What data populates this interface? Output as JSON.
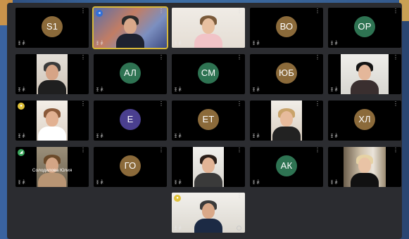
{
  "colors": {
    "tile_background": "#000000",
    "meeting_background": "#2b2c30",
    "active_speaker_border": "#d8b93a"
  },
  "icons": {
    "tile_status": "mic-muted-icon",
    "tile_menu": "more-options-icon"
  },
  "tiles": [
    {
      "kind": "avatar",
      "initials": "S1",
      "color": "#8b6a3a",
      "status": "ꀨ ꅕ"
    },
    {
      "kind": "video",
      "status": "ꀨ ꅕ",
      "badge": "◂",
      "badge_color": "#2f6fd8"
    },
    {
      "kind": "video",
      "status": "ꀨ ꅕ"
    },
    {
      "kind": "avatar",
      "initials": "ВО",
      "color": "#8b6a3a",
      "status": "ꀨ ꅕ"
    },
    {
      "kind": "avatar",
      "initials": "ОР",
      "color": "#2e7352",
      "status": "ꀨ ꅕ"
    },
    {
      "kind": "video",
      "status": "ꀨ ꅕ"
    },
    {
      "kind": "avatar",
      "initials": "АЛ",
      "color": "#2e7352",
      "status": "ꀨ ꅕ"
    },
    {
      "kind": "avatar",
      "initials": "СМ",
      "color": "#2e7352",
      "status": "ꀨ ꅕ"
    },
    {
      "kind": "avatar",
      "initials": "ЮБ",
      "color": "#8b6a3a",
      "status": "ꀨ ꅕ"
    },
    {
      "kind": "video",
      "status": "ꀨ ꅕ"
    },
    {
      "kind": "video",
      "status": "ꀨ ꅕ",
      "badge": "●",
      "badge_color": "#e0c23a"
    },
    {
      "kind": "avatar",
      "initials": "Е",
      "color": "#4a3f8f",
      "status": "ꀨ ꅕ"
    },
    {
      "kind": "avatar",
      "initials": "ЕТ",
      "color": "#8b6a3a",
      "status": "ꀨ ꅕ"
    },
    {
      "kind": "video",
      "status": "ꀨ ꅕ"
    },
    {
      "kind": "avatar",
      "initials": "ХЛ",
      "color": "#8b6a3a",
      "status": "ꀨ ꅕ"
    },
    {
      "kind": "video",
      "status": "ꀨ ꅕ",
      "badge": "◢",
      "badge_color": "#3aa55c",
      "overlay_name": "Солодилова Юлия"
    },
    {
      "kind": "avatar",
      "initials": "ГО",
      "color": "#8b6a3a",
      "status": "ꀨ ꅕ"
    },
    {
      "kind": "video",
      "status": "ꀨ ꅕ"
    },
    {
      "kind": "avatar",
      "initials": "АК",
      "color": "#2e7352",
      "status": "ꀨ ꅕ"
    },
    {
      "kind": "video",
      "status": "ꀨ ꅕ"
    },
    {
      "kind": "video",
      "status": "ꀨ ꅕ",
      "badge": "●",
      "badge_color": "#e0c23a"
    }
  ]
}
